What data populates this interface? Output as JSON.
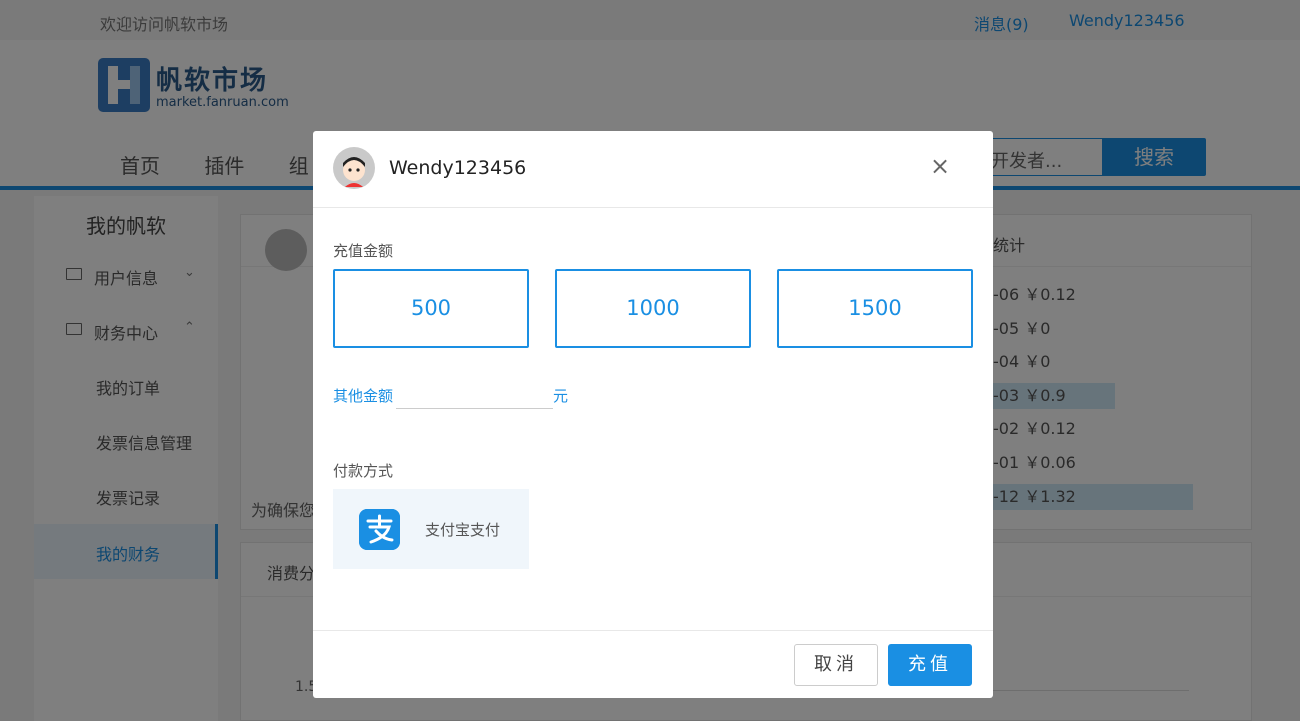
{
  "topbar": {
    "welcome": "欢迎访问帆软市场",
    "messages": "消息(9)",
    "username": "Wendy123456"
  },
  "header": {
    "logo_text": "帆软市场",
    "logo_sub": "market.fanruan.com",
    "nav": [
      "首页",
      "插件",
      "组"
    ],
    "search_placeholder": "开发者...",
    "search_button": "搜索"
  },
  "sidebar": {
    "title": "我的帆软",
    "items": [
      {
        "label": "用户信息",
        "caret": "⌄"
      },
      {
        "label": "财务中心",
        "caret": "⌃"
      },
      {
        "label": "我的订单"
      },
      {
        "label": "发票信息管理"
      },
      {
        "label": "发票记录"
      },
      {
        "label": "我的财务"
      }
    ]
  },
  "card1": {
    "stat_title": "统计",
    "note": "为确保您",
    "rows": [
      "-06 ￥0.12",
      "-05 ￥0",
      "-04 ￥0",
      "-03 ￥0.9",
      "-02 ￥0.12",
      "-01 ￥0.06",
      "-12 ￥1.32"
    ]
  },
  "card2": {
    "title": "消费分",
    "tick": "1.5"
  },
  "modal": {
    "username": "Wendy123456",
    "amount_label": "充值金额",
    "amounts": [
      "500",
      "1000",
      "1500"
    ],
    "other_label": "其他金额",
    "other_value": "",
    "unit": "元",
    "payment_label": "付款方式",
    "payment_method": "支付宝支付",
    "cancel": "取消",
    "confirm": "充值"
  },
  "colors": {
    "accent": "#1a8fe3",
    "overlay": "rgba(0,0,0,0.5)"
  }
}
